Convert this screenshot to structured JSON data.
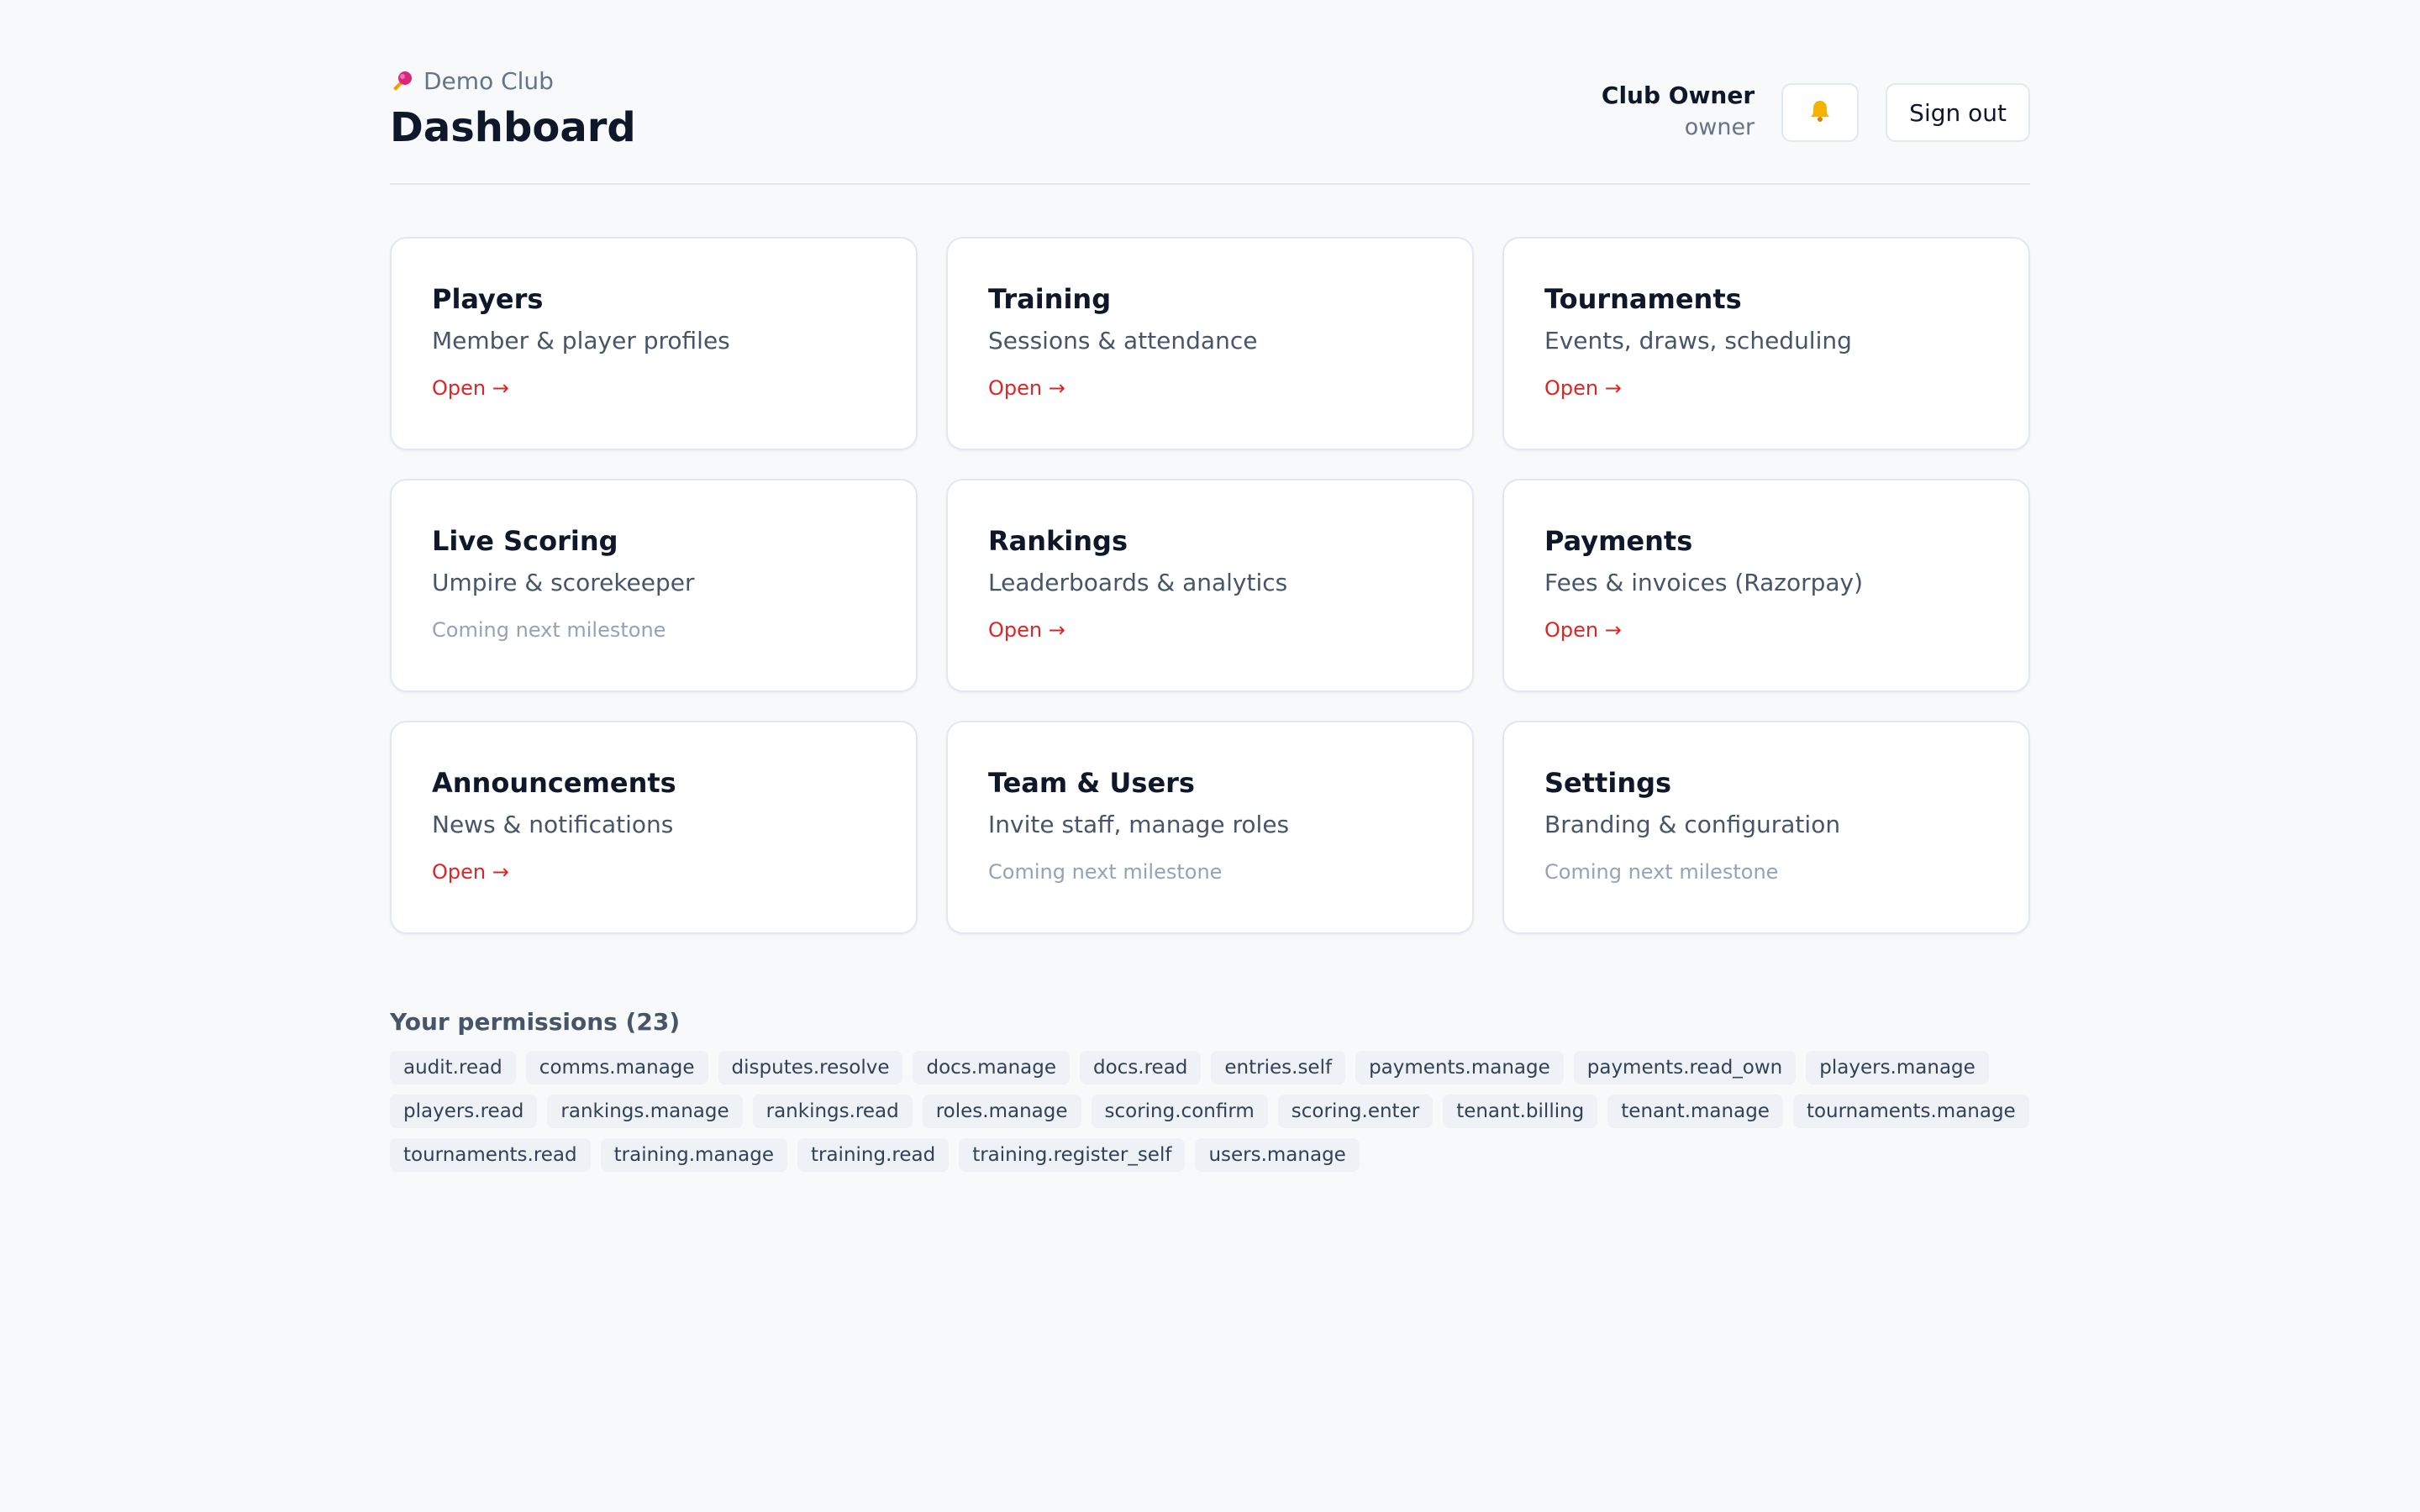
{
  "header": {
    "club_name": "Demo Club",
    "title": "Dashboard",
    "user_name": "Club Owner",
    "user_role": "owner",
    "bell_icon": "bell-icon",
    "signout_label": "Sign out"
  },
  "colors": {
    "accent": "#dc2626",
    "muted": "#94a3b8",
    "logo": "#db2777"
  },
  "cards": [
    {
      "title": "Players",
      "desc": "Member & player profiles",
      "link": "Open →",
      "status": "open"
    },
    {
      "title": "Training",
      "desc": "Sessions & attendance",
      "link": "Open →",
      "status": "open"
    },
    {
      "title": "Tournaments",
      "desc": "Events, draws, scheduling",
      "link": "Open →",
      "status": "open"
    },
    {
      "title": "Live Scoring",
      "desc": "Umpire & scorekeeper",
      "link": "Coming next milestone",
      "status": "soon"
    },
    {
      "title": "Rankings",
      "desc": "Leaderboards & analytics",
      "link": "Open →",
      "status": "open"
    },
    {
      "title": "Payments",
      "desc": "Fees & invoices (Razorpay)",
      "link": "Open →",
      "status": "open"
    },
    {
      "title": "Announcements",
      "desc": "News & notifications",
      "link": "Open →",
      "status": "open"
    },
    {
      "title": "Team & Users",
      "desc": "Invite staff, manage roles",
      "link": "Coming next milestone",
      "status": "soon"
    },
    {
      "title": "Settings",
      "desc": "Branding & configuration",
      "link": "Coming next milestone",
      "status": "soon"
    }
  ],
  "permissions": {
    "title": "Your permissions (23)",
    "items": [
      "audit.read",
      "comms.manage",
      "disputes.resolve",
      "docs.manage",
      "docs.read",
      "entries.self",
      "payments.manage",
      "payments.read_own",
      "players.manage",
      "players.read",
      "rankings.manage",
      "rankings.read",
      "roles.manage",
      "scoring.confirm",
      "scoring.enter",
      "tenant.billing",
      "tenant.manage",
      "tournaments.manage",
      "tournaments.read",
      "training.manage",
      "training.read",
      "training.register_self",
      "users.manage"
    ]
  }
}
